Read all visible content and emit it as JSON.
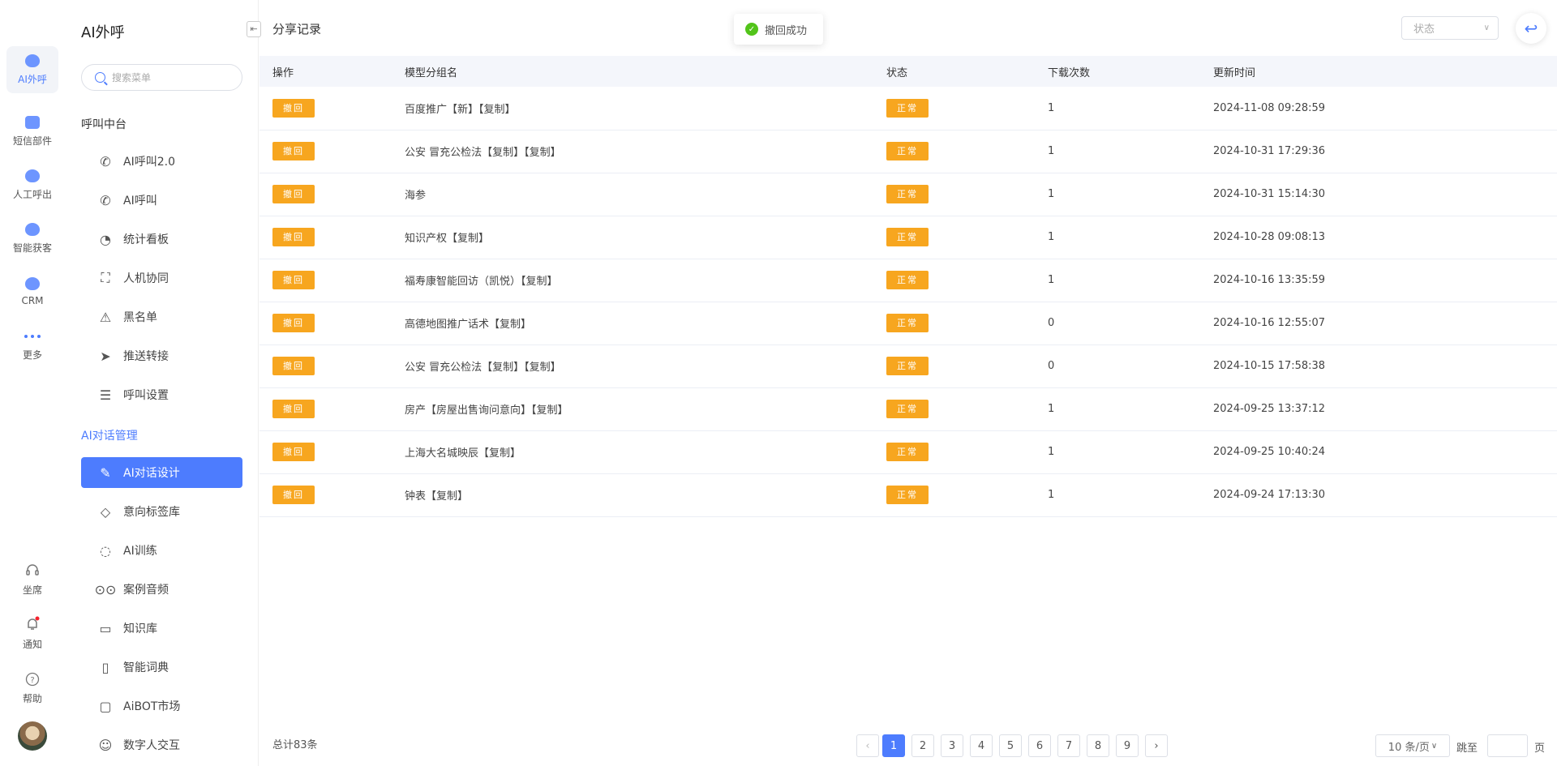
{
  "rail": {
    "items": [
      {
        "label": "AI外呼",
        "icon": "robot-icon"
      },
      {
        "label": "短信部件",
        "icon": "message-icon"
      },
      {
        "label": "人工呼出",
        "icon": "outbound-icon"
      },
      {
        "label": "智能获客",
        "icon": "acquire-icon"
      },
      {
        "label": "CRM",
        "icon": "crm-icon"
      },
      {
        "label": "更多",
        "icon": "more-icon"
      }
    ],
    "bottom": [
      {
        "label": "坐席",
        "icon": "headset-icon"
      },
      {
        "label": "通知",
        "icon": "bell-icon"
      },
      {
        "label": "帮助",
        "icon": "help-icon"
      }
    ]
  },
  "subnav": {
    "title": "AI外呼",
    "search_placeholder": "搜索菜单",
    "group1": "呼叫中台",
    "group1_items": [
      {
        "label": "AI呼叫2.0",
        "icon": "phone-call-icon"
      },
      {
        "label": "AI呼叫",
        "icon": "phone-icon"
      },
      {
        "label": "统计看板",
        "icon": "pie-chart-icon"
      },
      {
        "label": "人机协同",
        "icon": "face-scan-icon"
      },
      {
        "label": "黑名单",
        "icon": "warning-icon"
      },
      {
        "label": "推送转接",
        "icon": "send-icon"
      },
      {
        "label": "呼叫设置",
        "icon": "sliders-icon"
      }
    ],
    "group2": "AI对话管理",
    "group2_items": [
      {
        "label": "AI对话设计",
        "icon": "edit-icon"
      },
      {
        "label": "意向标签库",
        "icon": "tag-icon"
      },
      {
        "label": "AI训练",
        "icon": "chat-icon"
      },
      {
        "label": "案例音频",
        "icon": "voicemail-icon"
      },
      {
        "label": "知识库",
        "icon": "laptop-icon"
      },
      {
        "label": "智能词典",
        "icon": "book-icon"
      },
      {
        "label": "AiBOT市场",
        "icon": "messages-icon"
      },
      {
        "label": "数字人交互",
        "icon": "ghost-icon"
      }
    ]
  },
  "main": {
    "title": "分享记录",
    "toast": "撤回成功",
    "status_placeholder": "状态",
    "columns": [
      "操作",
      "模型分组名",
      "状态",
      "下载次数",
      "更新时间"
    ],
    "action_label": "撤回",
    "rows": [
      {
        "name": "百度推广【新】【复制】",
        "status": "正常",
        "downloads": "1",
        "updated": "2024-11-08 09:28:59"
      },
      {
        "name": "公安 冒充公检法【复制】【复制】",
        "status": "正常",
        "downloads": "1",
        "updated": "2024-10-31 17:29:36"
      },
      {
        "name": "海参",
        "status": "正常",
        "downloads": "1",
        "updated": "2024-10-31 15:14:30"
      },
      {
        "name": "知识产权【复制】",
        "status": "正常",
        "downloads": "1",
        "updated": "2024-10-28 09:08:13"
      },
      {
        "name": "福寿康智能回访（凯悦）【复制】",
        "status": "正常",
        "downloads": "1",
        "updated": "2024-10-16 13:35:59"
      },
      {
        "name": "高德地图推广话术【复制】",
        "status": "正常",
        "downloads": "0",
        "updated": "2024-10-16 12:55:07"
      },
      {
        "name": "公安 冒充公检法【复制】【复制】",
        "status": "正常",
        "downloads": "0",
        "updated": "2024-10-15 17:58:38"
      },
      {
        "name": "房产【房屋出售询问意向】【复制】",
        "status": "正常",
        "downloads": "1",
        "updated": "2024-09-25 13:37:12"
      },
      {
        "name": "上海大名城映辰【复制】",
        "status": "正常",
        "downloads": "1",
        "updated": "2024-09-25 10:40:24"
      },
      {
        "name": "钟表【复制】",
        "status": "正常",
        "downloads": "1",
        "updated": "2024-09-24 17:13:30"
      }
    ],
    "footer": {
      "total": "总计83条",
      "pages": [
        "1",
        "2",
        "3",
        "4",
        "5",
        "6",
        "7",
        "8",
        "9"
      ],
      "current_page": "1",
      "page_size": "10 条/页",
      "jump_label": "跳至",
      "page_suffix": "页"
    }
  },
  "colors": {
    "accent": "#4d7cfe",
    "warning": "#f7a61f",
    "success": "#52c41a"
  }
}
